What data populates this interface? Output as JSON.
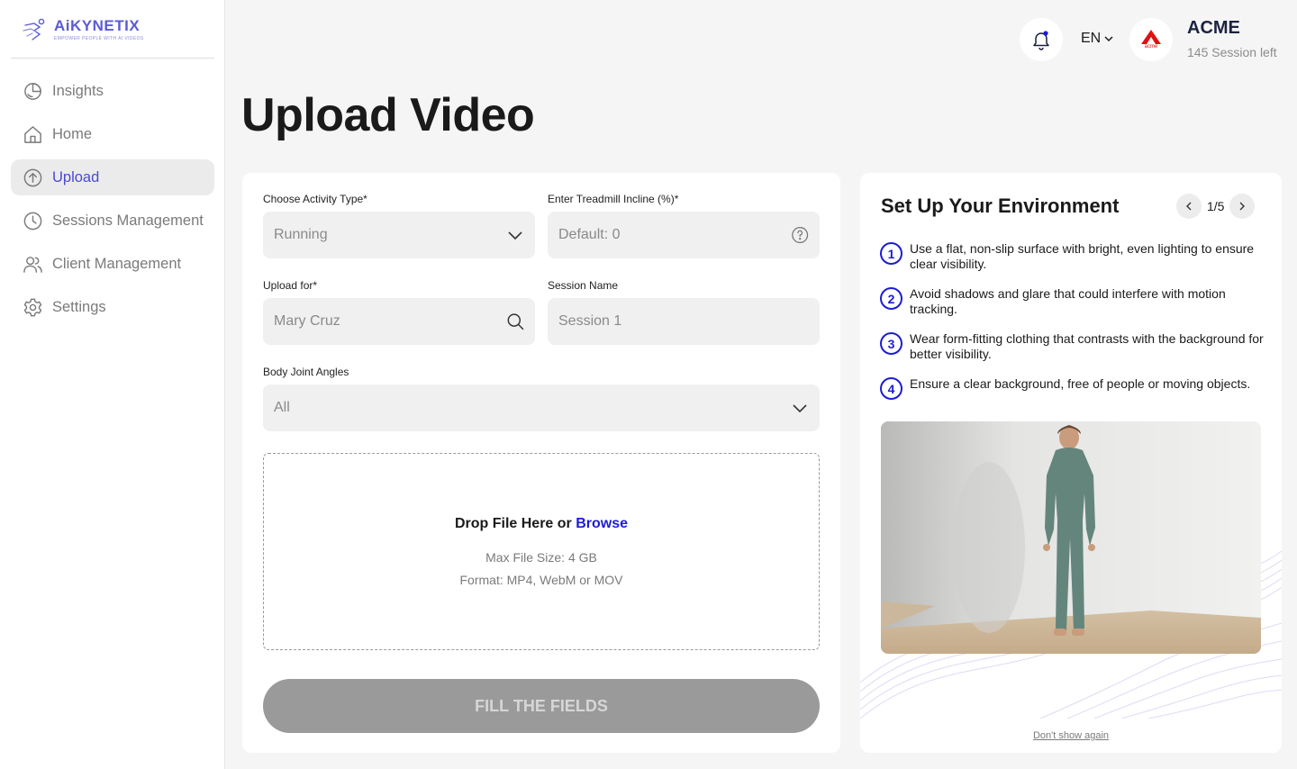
{
  "brand": {
    "name": "AiKYNETIX",
    "tagline": "EMPOWER PEOPLE WITH AI VIDEOS",
    "accent_color": "#5b5bd6"
  },
  "sidebar": {
    "items": [
      {
        "label": "Insights",
        "icon": "insights-icon",
        "active": false
      },
      {
        "label": "Home",
        "icon": "home-icon",
        "active": false
      },
      {
        "label": "Upload",
        "icon": "upload-icon",
        "active": true
      },
      {
        "label": "Sessions Management",
        "icon": "clock-icon",
        "active": false
      },
      {
        "label": "Client Management",
        "icon": "users-icon",
        "active": false
      },
      {
        "label": "Settings",
        "icon": "gear-icon",
        "active": false
      }
    ]
  },
  "topbar": {
    "language": "EN",
    "org_name": "ACME",
    "org_logo_text": "acme",
    "sessions_left": "145 Session left"
  },
  "page": {
    "title": "Upload Video"
  },
  "form": {
    "activity": {
      "label": "Choose Activity Type*",
      "value": "Running"
    },
    "incline": {
      "label": "Enter Treadmill Incline (%)*",
      "placeholder": "Default: 0"
    },
    "upload_for": {
      "label": "Upload for*",
      "placeholder": "Mary Cruz"
    },
    "session_name": {
      "label": "Session Name",
      "placeholder": "Session 1"
    },
    "joint_angles": {
      "label": "Body Joint Angles",
      "value": "All"
    },
    "dropzone": {
      "title": "Drop File Here or",
      "browse": "Browse",
      "max_size": "Max File Size: 4 GB",
      "formats": "Format: MP4, WebM or MOV"
    },
    "submit_label": "FILL THE FIELDS"
  },
  "environment": {
    "title": "Set Up Your Environment",
    "page_indicator": "1/5",
    "tips": [
      {
        "num": "1",
        "text": "Use a flat, non-slip surface with bright, even lighting to ensure clear visibility."
      },
      {
        "num": "2",
        "text": "Avoid shadows and glare that could interfere with motion tracking."
      },
      {
        "num": "3",
        "text": "Wear form-fitting clothing that contrasts with the background for better visibility."
      },
      {
        "num": "4",
        "text": "Ensure a clear background, free of people or moving objects."
      }
    ],
    "dont_show": "Don't show again"
  },
  "colors": {
    "link_blue": "#1c1cd6",
    "button_disabled": "#9a9a9a"
  }
}
